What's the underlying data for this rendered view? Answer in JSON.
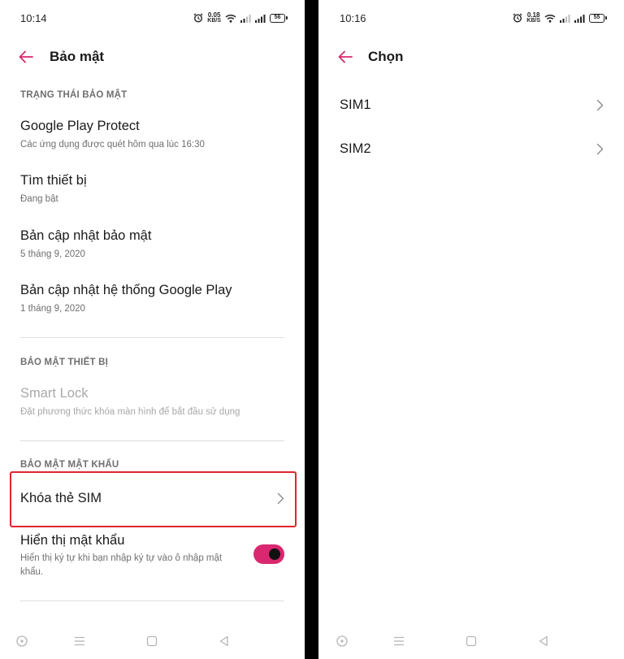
{
  "colors": {
    "accent": "#d9286f",
    "highlight": "#e0262c",
    "divider": "#000000"
  },
  "left": {
    "status": {
      "time": "10:14",
      "speed_value": "0.05",
      "speed_unit": "KB/S",
      "battery": "56"
    },
    "app_bar": {
      "title": "Bảo mật",
      "back_icon": "arrow-left-icon"
    },
    "sections": {
      "security_status": "TRẠNG THÁI BẢO MẬT",
      "device_security": "BẢO MẬT THIẾT BỊ",
      "password_security": "BẢO MẬT MẬT KHẨU"
    },
    "items": {
      "play_protect": {
        "title": "Google Play Protect",
        "subtitle": "Các ứng dụng được quét hôm qua lúc 16:30"
      },
      "find_device": {
        "title": "Tìm thiết bị",
        "subtitle": "Đang bật"
      },
      "security_update": {
        "title": "Bản cập nhật bảo mật",
        "subtitle": "5 tháng 9, 2020"
      },
      "play_system_update": {
        "title": "Bản cập nhật hệ thống Google Play",
        "subtitle": "1 tháng 9, 2020"
      },
      "smart_lock": {
        "title": "Smart Lock",
        "subtitle": "Đặt phương thức khóa màn hình để bắt đầu sử dụng"
      },
      "sim_lock": {
        "title": "Khóa thẻ SIM"
      },
      "show_password": {
        "title": "Hiển thị mật khẩu",
        "subtitle_line1": "Hiển thị ký tự khi bạn nhập ký tự vào ô nhập mật",
        "subtitle_line2": "khẩu.",
        "enabled": true
      }
    }
  },
  "right": {
    "status": {
      "time": "10:16",
      "speed_value": "0.18",
      "speed_unit": "KB/S",
      "battery": "55"
    },
    "app_bar": {
      "title": "Chọn",
      "back_icon": "arrow-left-icon"
    },
    "sims": [
      {
        "label": "SIM1"
      },
      {
        "label": "SIM2"
      }
    ]
  },
  "nav_icons": [
    "circle-nav-icon",
    "menu-nav-icon",
    "home-square-icon",
    "back-triangle-icon"
  ]
}
